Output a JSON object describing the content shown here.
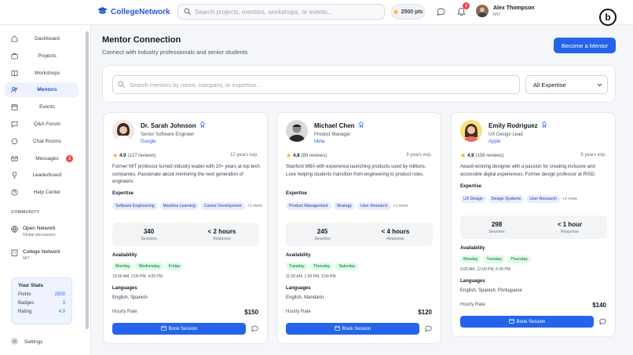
{
  "app": {
    "name": "CollegeNetwork"
  },
  "topbar": {
    "search_placeholder": "Search projects, mentors, workshops, or events...",
    "points": "2500 pts",
    "notif_count": "3",
    "user_name": "Alex Thompson",
    "user_school": "MIT",
    "corner_letter": "b"
  },
  "sidebar": {
    "items": [
      {
        "label": "Dashboard",
        "icon": "home-icon"
      },
      {
        "label": "Projects",
        "icon": "briefcase-icon"
      },
      {
        "label": "Workshops",
        "icon": "book-icon"
      },
      {
        "label": "Mentors",
        "icon": "users-icon"
      },
      {
        "label": "Events",
        "icon": "calendar-icon"
      },
      {
        "label": "Q&A Forum",
        "icon": "chat-bubble-icon"
      },
      {
        "label": "Chat Rooms",
        "icon": "chat-icon"
      },
      {
        "label": "Messages",
        "icon": "mail-icon",
        "badge": "3"
      },
      {
        "label": "Leaderboard",
        "icon": "trophy-icon"
      },
      {
        "label": "Help Center",
        "icon": "help-icon"
      }
    ],
    "community_heading": "COMMUNITY",
    "community": [
      {
        "title": "Open Network",
        "sub": "Global discussions"
      },
      {
        "title": "College Network",
        "sub": "MIT"
      }
    ],
    "stats": {
      "heading": "Your Stats",
      "rows": [
        {
          "k": "Points",
          "v": "2500"
        },
        {
          "k": "Badges",
          "v": "3"
        },
        {
          "k": "Rating",
          "v": "4.9"
        }
      ]
    },
    "settings": "Settings"
  },
  "page": {
    "title": "Mentor Connection",
    "subtitle": "Connect with industry professionals and senior students",
    "cta": "Become a Mentor",
    "search_placeholder": "Search mentors by name, company, or expertise...",
    "filter": "All Expertise"
  },
  "labels": {
    "expertise": "Expertise",
    "availability": "Availability",
    "languages": "Languages",
    "hourly": "Hourly Rate",
    "book": "Book Session",
    "sessions": "Sessions",
    "response": "Response"
  },
  "mentors": [
    {
      "name": "Dr. Sarah Johnson",
      "role": "Senior Software Engineer",
      "company": "Google",
      "rating": "4.9",
      "reviews": "(127 reviews)",
      "exp": "12 years exp.",
      "bio": "Former MIT professor turned industry leader with 10+ years at top tech companies. Passionate about mentoring the next generation of engineers.",
      "tags": [
        "Software Engineering",
        "Machine Learning",
        "Career Development"
      ],
      "more": "+1 more",
      "sessions": "340",
      "response": "< 2 hours",
      "days": [
        "Monday",
        "Wednesday",
        "Friday"
      ],
      "times": "10:00 AM, 2:00 PM, 4:00 PM",
      "languages": "English, Spanish",
      "rate": "$150"
    },
    {
      "name": "Michael Chen",
      "role": "Product Manager",
      "company": "Meta",
      "rating": "4.8",
      "reviews": "(89 reviews)",
      "exp": "8 years exp.",
      "bio": "Stanford MBA with experience launching products used by millions. Love helping students transition from engineering to product roles.",
      "tags": [
        "Product Management",
        "Strategy",
        "User Research"
      ],
      "more": "+1 more",
      "sessions": "245",
      "response": "< 4 hours",
      "days": [
        "Tuesday",
        "Thursday",
        "Saturday"
      ],
      "times": "11:00 AM, 1:00 PM, 3:00 PM",
      "languages": "English, Mandarin",
      "rate": "$120"
    },
    {
      "name": "Emily Rodriguez",
      "role": "UX Design Lead",
      "company": "Apple",
      "rating": "4.9",
      "reviews": "(156 reviews)",
      "exp": "9 years exp.",
      "bio": "Award-winning designer with a passion for creating inclusive and accessible digital experiences. Former design professor at RISD.",
      "tags": [
        "UX Design",
        "Design Systems",
        "User Research"
      ],
      "more": "+1 more",
      "sessions": "298",
      "response": "< 1 hour",
      "days": [
        "Monday",
        "Tuesday",
        "Thursday"
      ],
      "times": "9:00 AM, 12:00 PM, 5:00 PM",
      "languages": "English, Spanish, Portuguese",
      "rate": "$140"
    }
  ]
}
